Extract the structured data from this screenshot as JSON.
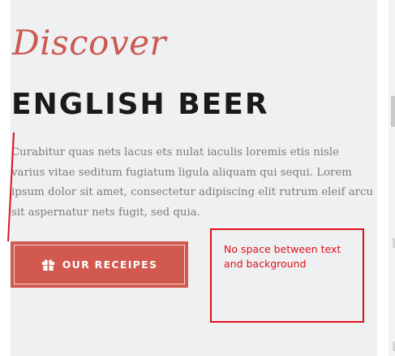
{
  "hero": {
    "script_title": "Discover",
    "main_title": "ENGLISH BEER",
    "body_text": "Curabitur quas nets lacus ets nulat iaculis loremis etis nisle varius vitae seditum fugiatum ligula aliquam qui sequi. Lorem ipsum dolor sit amet, consectetur adipiscing elit rutrum eleif arcu sit aspernatur nets fugit, sed quia.",
    "button": {
      "label": "OUR RECEIPES",
      "icon": "gift-icon"
    }
  },
  "annotation": {
    "note": "No space between text and background",
    "color": "#e0101a"
  },
  "colors": {
    "accent": "#d2594f",
    "script": "#cb5a50",
    "panel_background": "#eff0f2",
    "body_text": "#7b7b7b",
    "heading": "#1a1a1a"
  }
}
